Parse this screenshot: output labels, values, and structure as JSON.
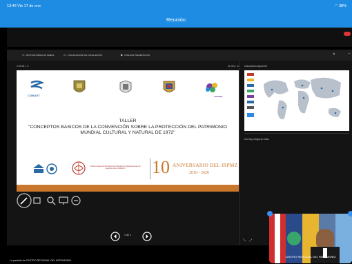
{
  "status_bar": {
    "time": "13:46",
    "date": "Vie 17 de ene",
    "battery": "38%"
  },
  "window": {
    "title": "Reunión"
  },
  "toolbar": {
    "items": [
      {
        "label": "MOSTRAR BARRA DE TAREAS",
        "icon": "taskbar-icon"
      },
      {
        "label": "CONFIGURACIÓN DE VISUALIZACIÓN",
        "icon": "display-settings-icon"
      },
      {
        "label": "FINALIZAR PRESENTACIÓN",
        "icon": "end-presentation-icon"
      }
    ]
  },
  "presenter": {
    "slide_counter": "0:00:26",
    "clock": "01:46 p. m.",
    "next_slide_label": "Diapositiva siguiente",
    "notes": "No hay ninguna nota.",
    "pager": "1 de 1"
  },
  "slide": {
    "logo1_text": "CONAET",
    "logo2_text": "CONAET",
    "title": "TALLER",
    "subtitle": "\"CONCEPTOS BASICOS DE LA CONVENCIÓN SOBRE LA PROTECCIÓN DEL PATRIMONIO MUNDIAL CULTURAL Y NATURAL DE 1972\"",
    "irpmz_text": "Instituto Regional del Patrimonio Mundial en Zacatecas bajo los auspicios de la UNESCO",
    "anniversary_number": "10",
    "anniversary_text": "ANIVERSARIO DEL IRPMZ",
    "anniversary_years": "2010 - 2020",
    "bar_color": "#c9772c"
  },
  "bottom": {
    "share_text": "La pantalla de CENTRO REGIONAL DEL PATRIMONIO"
  },
  "video": {
    "participant_name": "CENTRO REGIONAL DEL PATRIMONIO"
  },
  "colors": {
    "accent": "#1e8ce3",
    "record": "#e03535"
  }
}
